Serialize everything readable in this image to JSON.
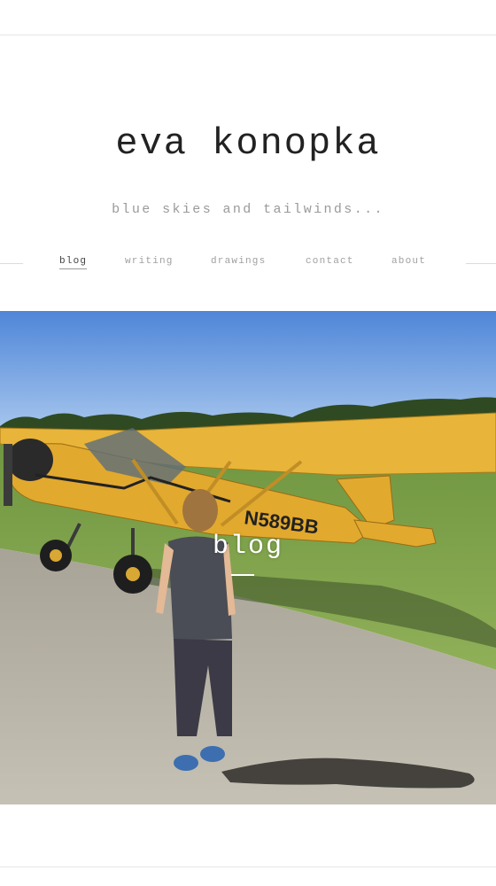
{
  "site": {
    "title": "eva konopka",
    "tagline": "blue skies and tailwinds..."
  },
  "nav": {
    "items": [
      {
        "label": "blog",
        "active": true
      },
      {
        "label": "writing",
        "active": false
      },
      {
        "label": "drawings",
        "active": false
      },
      {
        "label": "contact",
        "active": false
      },
      {
        "label": "about",
        "active": false
      }
    ]
  },
  "hero": {
    "label": "blog",
    "plane_registration": "N589BB"
  },
  "colors": {
    "sky": "#6f9fe0",
    "plane": "#e8b43a",
    "grass": "#7ea04a",
    "tarmac": "#b7b2a6",
    "title": "#222222",
    "muted": "#9a9a9a"
  }
}
